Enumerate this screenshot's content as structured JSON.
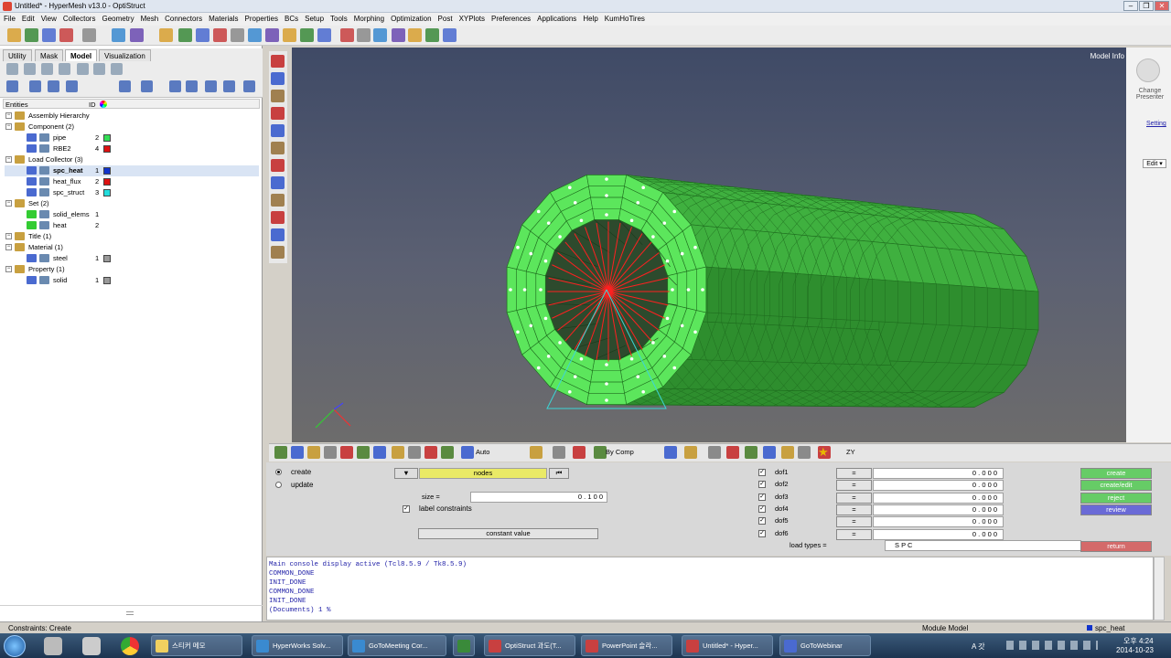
{
  "window": {
    "title": "Untitled* - HyperMesh v13.0 - OptiStruct"
  },
  "menu": [
    "File",
    "Edit",
    "View",
    "Collectors",
    "Geometry",
    "Mesh",
    "Connectors",
    "Materials",
    "Properties",
    "BCs",
    "Setup",
    "Tools",
    "Morphing",
    "Optimization",
    "Post",
    "XYPlots",
    "Preferences",
    "Applications",
    "Help",
    "KumHoTires"
  ],
  "tabs": [
    "Utility",
    "Mask",
    "Model",
    "Visualization"
  ],
  "active_tab": "Model",
  "entities_header": {
    "entities": "Entities",
    "id": "ID"
  },
  "tree": [
    {
      "label": "Assembly Hierarchy",
      "level": 0,
      "id": "",
      "color": ""
    },
    {
      "label": "Component (2)",
      "level": 0,
      "id": "",
      "color": ""
    },
    {
      "label": "pipe",
      "level": 1,
      "id": "2",
      "color": "#33dd55"
    },
    {
      "label": "RBE2",
      "level": 1,
      "id": "4",
      "color": "#dd1111"
    },
    {
      "label": "Load Collector (3)",
      "level": 0,
      "id": "",
      "color": ""
    },
    {
      "label": "spc_heat",
      "level": 1,
      "id": "1",
      "color": "#1133cc",
      "selected": true
    },
    {
      "label": "heat_flux",
      "level": 1,
      "id": "2",
      "color": "#dd1111"
    },
    {
      "label": "spc_struct",
      "level": 1,
      "id": "3",
      "color": "#22dddd"
    },
    {
      "label": "Set (2)",
      "level": 0,
      "id": "",
      "color": ""
    },
    {
      "label": "solid_elems",
      "level": 1,
      "id": "1",
      "color": ""
    },
    {
      "label": "heat",
      "level": 1,
      "id": "2",
      "color": ""
    },
    {
      "label": "Title (1)",
      "level": 0,
      "id": "",
      "color": ""
    },
    {
      "label": "Material (1)",
      "level": 0,
      "id": "",
      "color": ""
    },
    {
      "label": "steel",
      "level": 1,
      "id": "1",
      "color": "#999999"
    },
    {
      "label": "Property (1)",
      "level": 0,
      "id": "",
      "color": ""
    },
    {
      "label": "solid",
      "level": 1,
      "id": "1",
      "color": "#999999"
    }
  ],
  "viewport": {
    "model_info": "Model Info"
  },
  "right_panel": {
    "change_presenter": "Change Presenter",
    "setting": "Setting",
    "edit": "Edit ▾"
  },
  "bottom_toolbar": {
    "auto": "Auto",
    "by_comp": "By Comp",
    "zy": "ZY"
  },
  "panel": {
    "create": "create",
    "update": "update",
    "nodes": "nodes",
    "size_label": "size =",
    "size_value": "0 . 1 0 0",
    "label_constraints": "label constraints",
    "constant_value": "constant value",
    "dofs": [
      {
        "label": "dof1",
        "value": "0 . 0 0 0"
      },
      {
        "label": "dof2",
        "value": "0 . 0 0 0"
      },
      {
        "label": "dof3",
        "value": "0 . 0 0 0"
      },
      {
        "label": "dof4",
        "value": "0 . 0 0 0"
      },
      {
        "label": "dof5",
        "value": "0 . 0 0 0"
      },
      {
        "label": "dof6",
        "value": "0 . 0 0 0"
      }
    ],
    "eq": "=",
    "load_types_label": "load types =",
    "load_types_value": "S P C",
    "actions": [
      "create",
      "create/edit",
      "reject",
      "review"
    ],
    "return": "return"
  },
  "console": [
    "Main console display active (Tcl8.5.9 / Tk8.5.9)",
    "COMMON_DONE",
    "INIT_DONE",
    "COMMON_DONE",
    "INIT_DONE",
    "(Documents) 1 %"
  ],
  "status": {
    "left": "Constraints: Create",
    "module": "Module Model",
    "current": "spc_heat"
  },
  "taskbar": {
    "items": [
      "스티커 메모",
      "HyperWorks Solv...",
      "GoToMeeting Cor...",
      "",
      "OptiStruct 과도(T...",
      "PowerPoint 슬라...",
      "Untitled* - Hyper...",
      "GoToWebinar"
    ],
    "time": "오후 4:24",
    "date": "2014-10-23",
    "lang": "A 갓"
  },
  "colors": {
    "mesh_green": "#5ce65c",
    "edges": "#1f6e1f",
    "spc": "#ff2020",
    "create_btn": "#66cc66",
    "review_btn": "#6a6ad6",
    "return_btn": "#d46a6a",
    "nodes_field": "#eaea66"
  }
}
